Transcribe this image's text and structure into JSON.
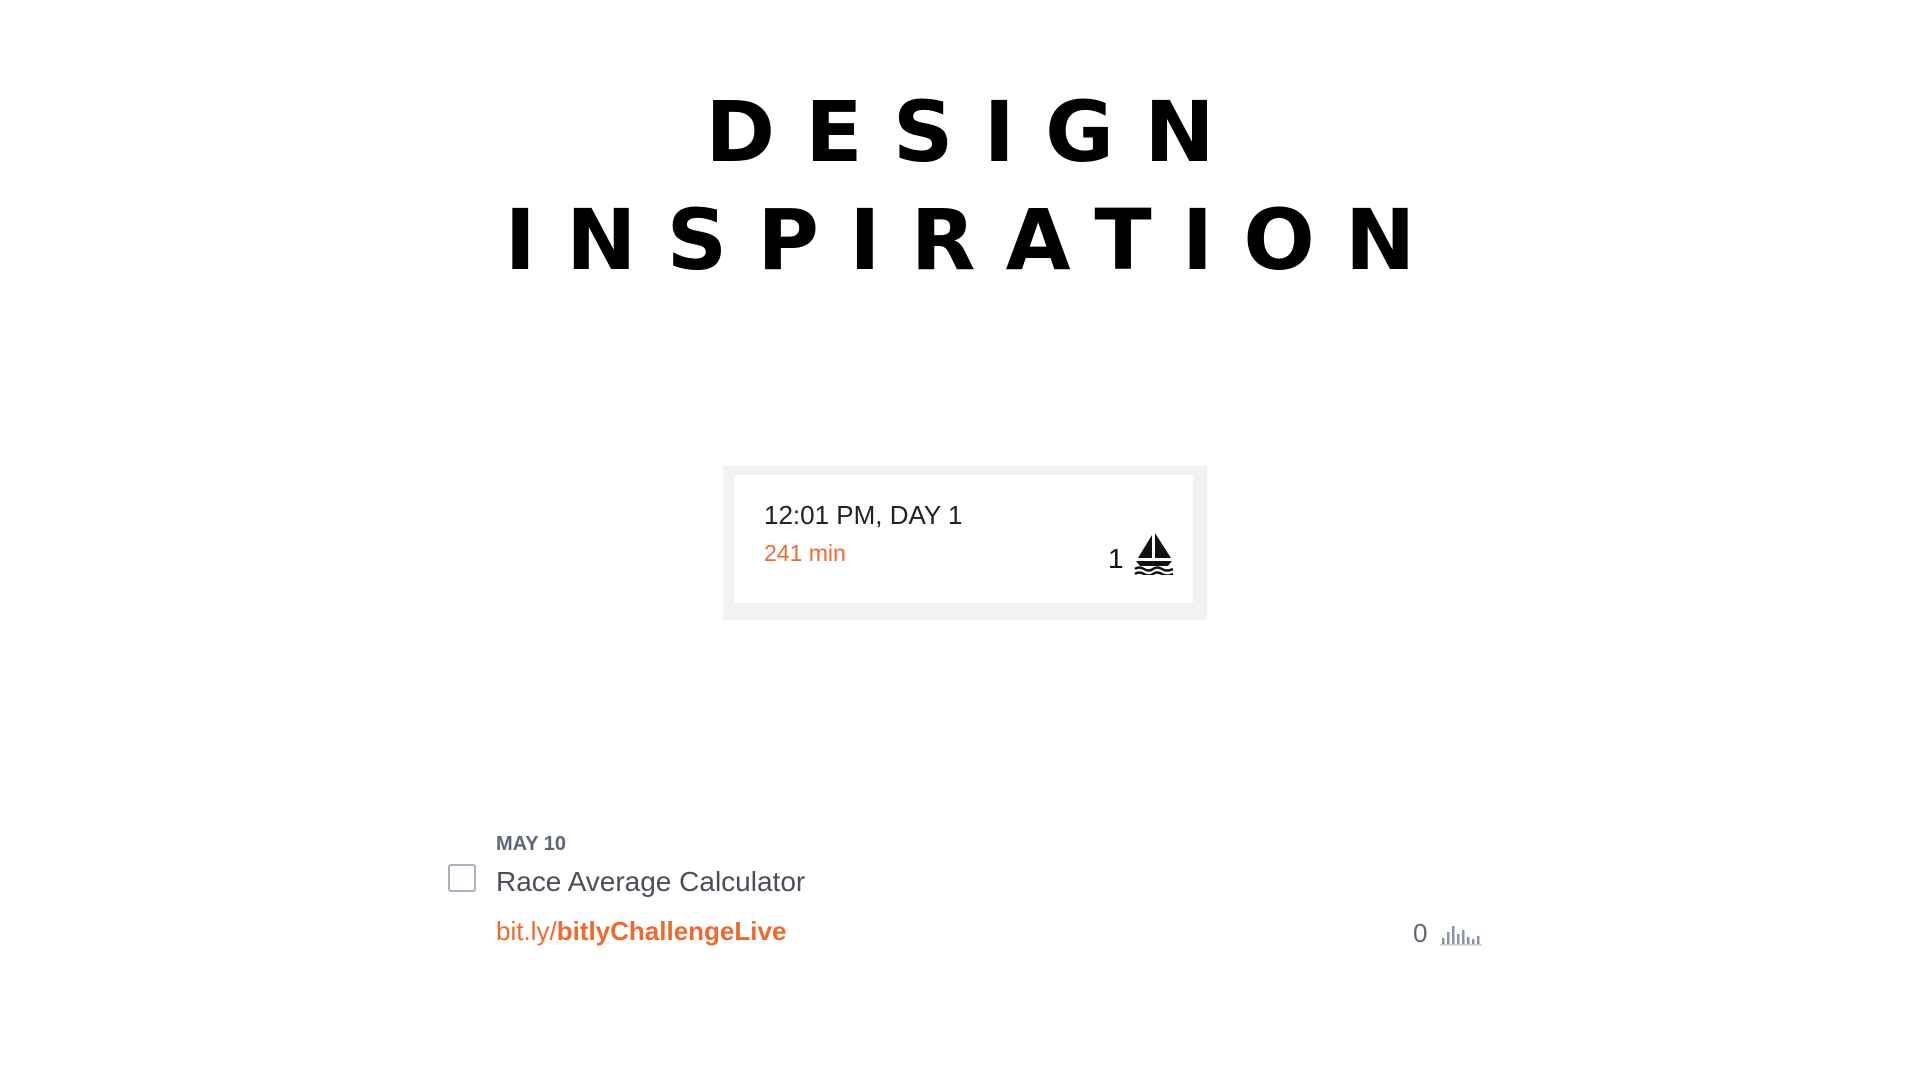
{
  "header": {
    "title_line_1": "DESIGN",
    "title_line_2": "INSPIRATION"
  },
  "race_card": {
    "time": "12:01 PM, DAY 1",
    "duration": "241 min",
    "count": "1",
    "icon": "sailboat-icon",
    "duration_color": "#ee6a2e"
  },
  "link_item": {
    "date": "MAY 10",
    "title": "Race Average Calculator",
    "link_domain": "bit.ly/",
    "link_path": "bitlyChallengeLive",
    "clicks": "0",
    "stats_icon": "bar-chart-icon",
    "checked": false,
    "accent_color": "#ee6a2e"
  }
}
